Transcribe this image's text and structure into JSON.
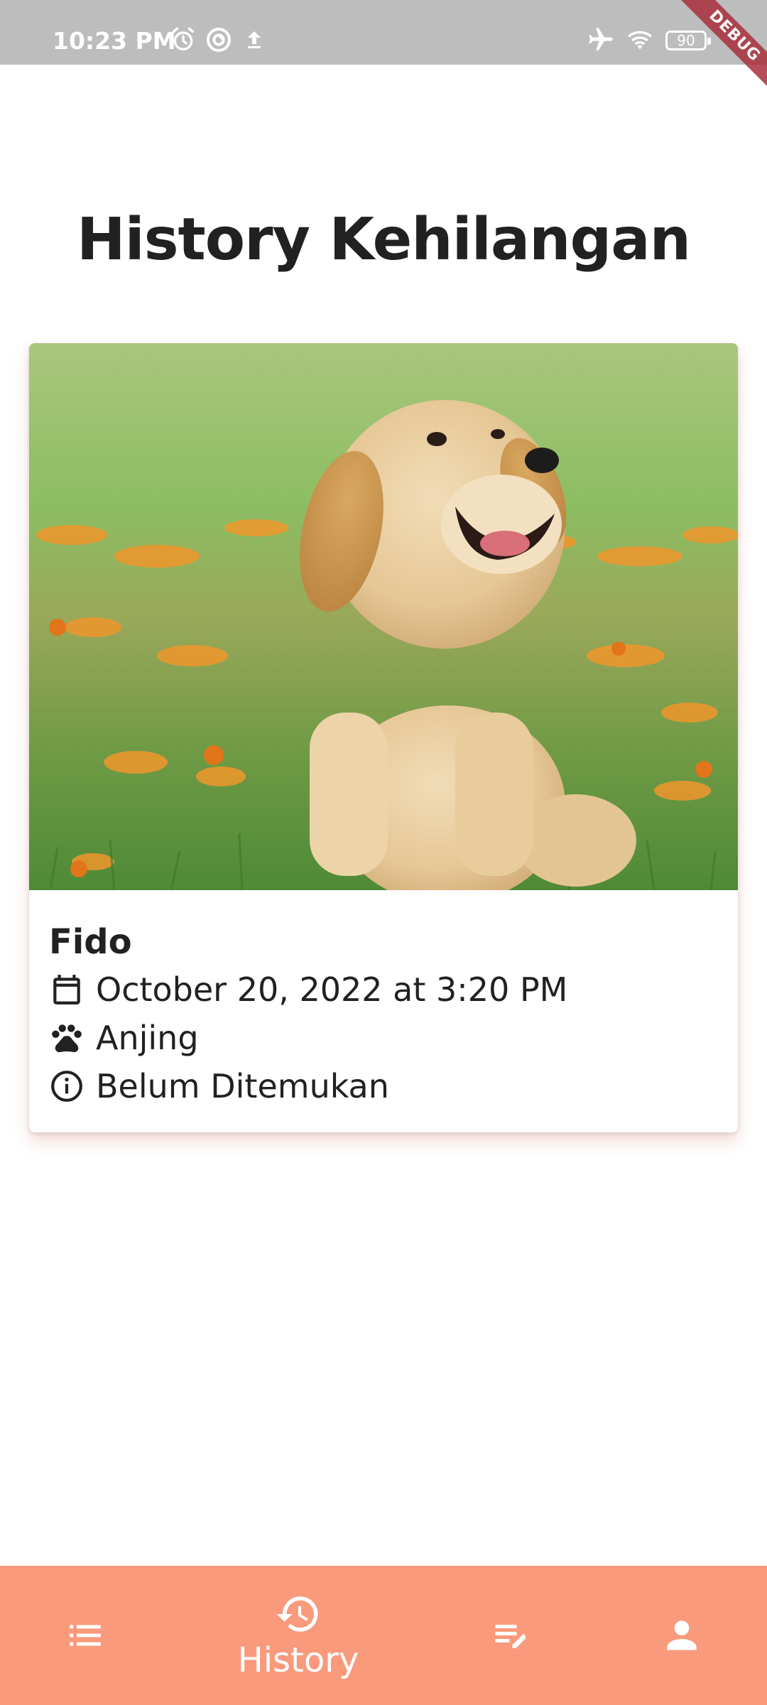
{
  "status_bar": {
    "time": "10:23 PM",
    "battery": "90",
    "debug_label": "DEBUG"
  },
  "page": {
    "title": "History Kehilangan"
  },
  "history_card": {
    "name": "Fido",
    "datetime": "October 20, 2022 at 3:20 PM",
    "species": "Anjing",
    "status": "Belum Ditemukan"
  },
  "bottom_nav": {
    "items": [
      {
        "icon": "list-icon",
        "label": ""
      },
      {
        "icon": "history-icon",
        "label": "History"
      },
      {
        "icon": "edit-note-icon",
        "label": ""
      },
      {
        "icon": "person-icon",
        "label": ""
      }
    ],
    "active_index": 1
  },
  "colors": {
    "status_bar": "#bdbdbd",
    "nav_background": "#f99a7c",
    "debug_ribbon": "#a8303b",
    "text": "#212121"
  }
}
